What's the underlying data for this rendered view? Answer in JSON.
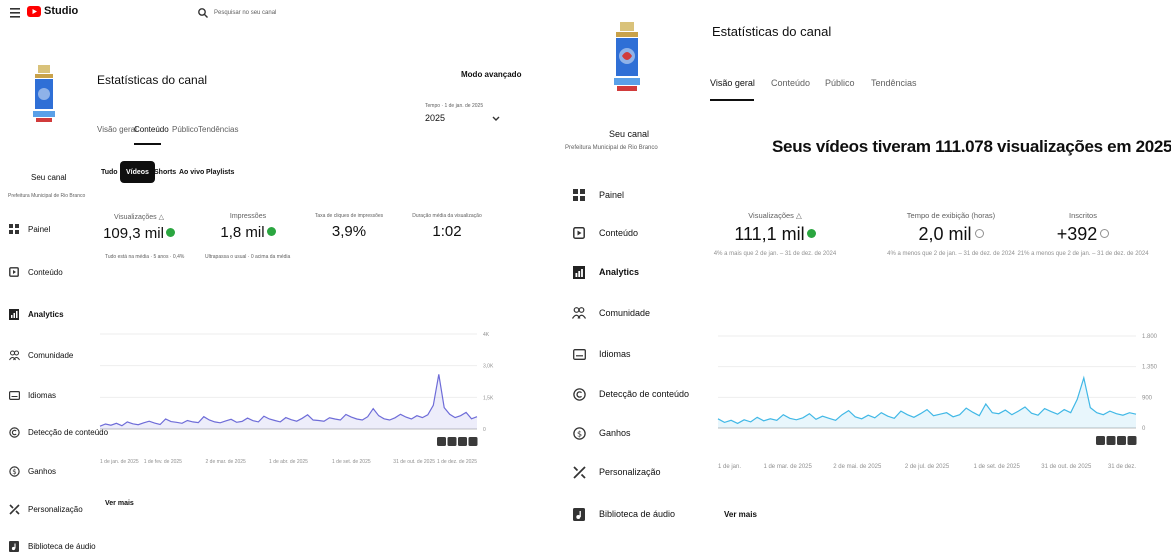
{
  "left": {
    "topbar": {
      "studio_label": "Studio",
      "search_placeholder": "Pesquisar no seu canal"
    },
    "channel": {
      "name": "Seu canal",
      "subtitle": "Prefeitura Municipal de Rio Branco"
    },
    "nav": [
      {
        "label": "Painel",
        "icon": "dashboard-icon"
      },
      {
        "label": "Conteúdo",
        "icon": "content-icon"
      },
      {
        "label": "Analytics",
        "icon": "analytics-icon",
        "active": true
      },
      {
        "label": "Comunidade",
        "icon": "community-icon"
      },
      {
        "label": "Idiomas",
        "icon": "subtitles-icon"
      },
      {
        "label": "Detecção de conteúdo",
        "icon": "copyright-icon"
      },
      {
        "label": "Ganhos",
        "icon": "dollar-icon"
      },
      {
        "label": "Personalização",
        "icon": "customization-icon"
      },
      {
        "label": "Biblioteca de áudio",
        "icon": "audio-library-icon"
      }
    ],
    "page_title": "Estatísticas do canal",
    "advanced_mode": "Modo avançado",
    "period": {
      "label": "Tempo · 1 de jan. de 2025",
      "value": "2025"
    },
    "tabs": [
      "Visão geral",
      "Conteúdo",
      "Público",
      "Tendências"
    ],
    "active_tab": 1,
    "chips": [
      "Tudo",
      "Vídeos",
      "Shorts",
      "Ao vivo",
      "Playlists"
    ],
    "active_chip": 1,
    "metrics": [
      {
        "label": "Visualizações",
        "value": "109,3 mil",
        "status": "ok",
        "has_info": true
      },
      {
        "label": "Impressões",
        "value": "1,8 mil",
        "status": "ok"
      },
      {
        "label": "Taxa de cliques de impressões",
        "value": "3,9%"
      },
      {
        "label": "Duração média da visualização",
        "value": "1:02"
      }
    ],
    "metric_notes": [
      "Tudo está na média · 5 anos · 0,4%",
      "Ultrapassa o usual · 0 acima da média"
    ],
    "y_ticks": [
      "4K",
      "3,0K",
      "1,5K",
      "0"
    ],
    "x_ticks": [
      "1 de jan. de 2025",
      "1 de fev. de 2025",
      "2 de mar. de 2025",
      "1 de abr. de 2025",
      "1 de set. de 2025",
      "31 de out. de 2025",
      "1 de dez. de 2025"
    ],
    "see_more": "Ver mais"
  },
  "right": {
    "channel": {
      "name": "Seu canal",
      "subtitle": "Prefeitura Municipal de Rio Branco"
    },
    "nav": [
      {
        "label": "Painel",
        "icon": "dashboard-icon"
      },
      {
        "label": "Conteúdo",
        "icon": "content-icon"
      },
      {
        "label": "Analytics",
        "icon": "analytics-icon",
        "active": true
      },
      {
        "label": "Comunidade",
        "icon": "community-icon"
      },
      {
        "label": "Idiomas",
        "icon": "subtitles-icon"
      },
      {
        "label": "Detecção de conteúdo",
        "icon": "copyright-icon"
      },
      {
        "label": "Ganhos",
        "icon": "dollar-icon"
      },
      {
        "label": "Personalização",
        "icon": "customization-icon"
      },
      {
        "label": "Biblioteca de áudio",
        "icon": "audio-library-icon"
      }
    ],
    "page_title": "Estatísticas do canal",
    "tabs": [
      "Visão geral",
      "Conteúdo",
      "Público",
      "Tendências"
    ],
    "active_tab": 0,
    "headline": "Seus vídeos tiveram 111.078 visualizações em 2025",
    "metrics": [
      {
        "label": "Visualizações",
        "value": "111,1 mil",
        "status": "ok",
        "has_info": true,
        "note": "4% a mais que 2 de jan. – 31 de dez. de 2024"
      },
      {
        "label": "Tempo de exibição (horas)",
        "value": "2,0 mil",
        "status": "neutral",
        "note": "4% a menos que 2 de jan. – 31 de dez. de 2024"
      },
      {
        "label": "Inscritos",
        "value": "+392",
        "status": "neutral",
        "note": "21% a menos que 2 de jan. – 31 de dez. de 2024"
      }
    ],
    "y_ticks": [
      "1.800",
      "1.350",
      "900",
      "0"
    ],
    "x_ticks": [
      "1 de jan.",
      "1 de mar. de 2025",
      "2 de mai. de 2025",
      "2 de jul. de 2025",
      "1 de set. de 2025",
      "31 de out. de 2025",
      "31 de dez."
    ],
    "see_more": "Ver mais"
  },
  "chart_data": [
    {
      "type": "line",
      "panel": "left",
      "title": "",
      "xlabel": "",
      "ylabel": "",
      "x_range": [
        "2025-01-01",
        "2025-12-31"
      ],
      "ylim": [
        0,
        4000
      ],
      "series": [
        {
          "color": "#6e6cd8",
          "values": [
            120,
            210,
            160,
            240,
            140,
            300,
            220,
            180,
            260,
            330,
            250,
            190,
            420,
            310,
            280,
            240,
            360,
            300,
            270,
            520,
            380,
            300,
            260,
            340,
            410,
            280,
            320,
            460,
            350,
            300,
            540,
            420,
            360,
            300,
            480,
            390,
            330,
            450,
            600,
            380,
            360,
            330,
            470,
            420,
            380,
            610,
            500,
            420,
            380,
            520,
            860,
            560,
            430,
            380,
            470,
            620,
            500,
            420,
            560,
            480,
            600,
            1000,
            2300,
            900,
            620,
            480,
            560,
            700,
            430,
            520
          ]
        }
      ]
    },
    {
      "type": "line",
      "panel": "right",
      "title": "Visualizações",
      "xlabel": "",
      "ylabel": "",
      "x_range": [
        "2025-01-01",
        "2025-12-31"
      ],
      "ylim": [
        0,
        1800
      ],
      "series": [
        {
          "name": "Visualizações",
          "color": "#41b8e6",
          "values": [
            180,
            110,
            150,
            90,
            160,
            120,
            210,
            140,
            180,
            150,
            260,
            190,
            160,
            200,
            280,
            170,
            230,
            190,
            150,
            260,
            340,
            220,
            180,
            250,
            200,
            300,
            230,
            190,
            330,
            260,
            210,
            280,
            360,
            240,
            270,
            300,
            220,
            260,
            390,
            310,
            240,
            470,
            300,
            280,
            350,
            260,
            330,
            410,
            290,
            250,
            380,
            320,
            270,
            360,
            300,
            560,
            980,
            400,
            300,
            260,
            330,
            280,
            250,
            300,
            270
          ]
        }
      ]
    }
  ]
}
